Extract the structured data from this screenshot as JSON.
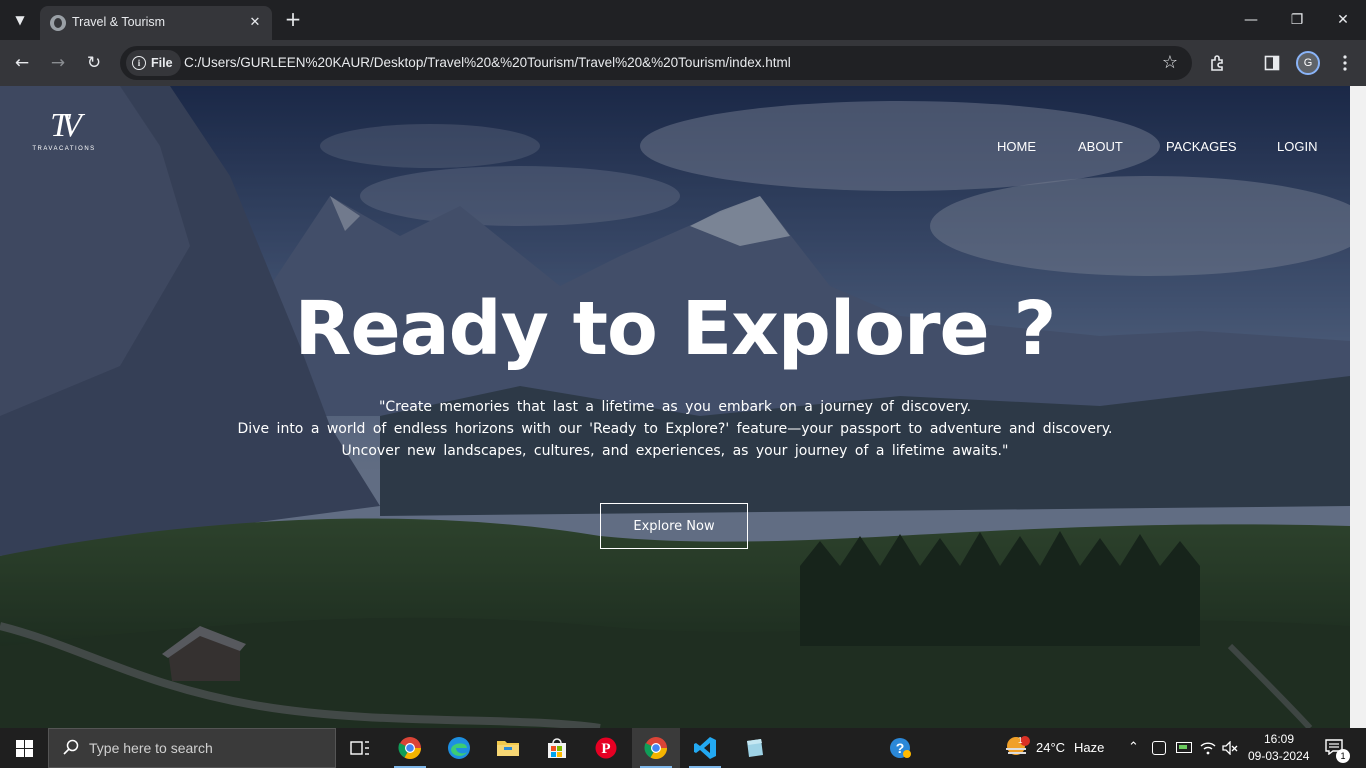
{
  "browser": {
    "tab_title": "Travel & Tourism",
    "chip_label": "File",
    "url": "C:/Users/GURLEEN%20KAUR/Desktop/Travel%20&%20Tourism/Travel%20&%20Tourism/index.html",
    "profile_initial": "G"
  },
  "site": {
    "logo_mark": "TV",
    "logo_text": "TRAVACATIONS",
    "nav": [
      "HOME",
      "ABOUT",
      "PACKAGES",
      "LOGIN"
    ],
    "hero_title": "Ready to Explore ?",
    "hero_lines": [
      "\"Create memories that last a lifetime as you embark on a journey of discovery.",
      "Dive into a world of endless horizons with our 'Ready to Explore?' feature—your passport to adventure and discovery.",
      "Uncover new landscapes, cultures, and experiences, as your journey of a lifetime awaits.\""
    ],
    "cta_label": "Explore Now"
  },
  "taskbar": {
    "search_placeholder": "Type here to search",
    "weather_temp": "24°C",
    "weather_desc": "Haze",
    "weather_badge": "1",
    "time": "16:09",
    "date": "09-03-2024",
    "notification_count": "1"
  },
  "colors": {
    "chrome_dark": "#202124",
    "chrome_toolbar": "#35363a",
    "taskbar": "#1f1f1f",
    "accent": "#7eb6e8"
  }
}
